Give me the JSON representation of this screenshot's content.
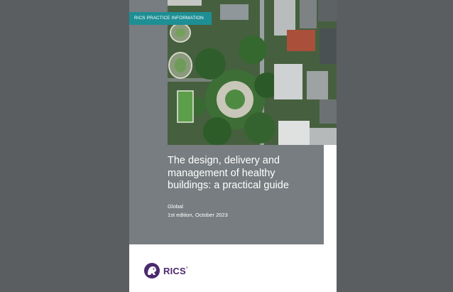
{
  "document": {
    "label_tab": "RICS PRACTICE INFORMATION",
    "title": "The design, delivery and management of healthy buildings: a practical guide",
    "region": "Global",
    "edition": "1st edition, October 2023",
    "cover_image": "aerial-city-park-photo"
  },
  "brand": {
    "name": "RICS",
    "registered_mark": "®",
    "logo_icon": "rics-lion-logo-icon"
  },
  "colors": {
    "viewer_background": "#5b5e60",
    "panel_grey": "#777d80",
    "tab_teal": "#1e8f94",
    "brand_purple": "#4b2a6e"
  }
}
